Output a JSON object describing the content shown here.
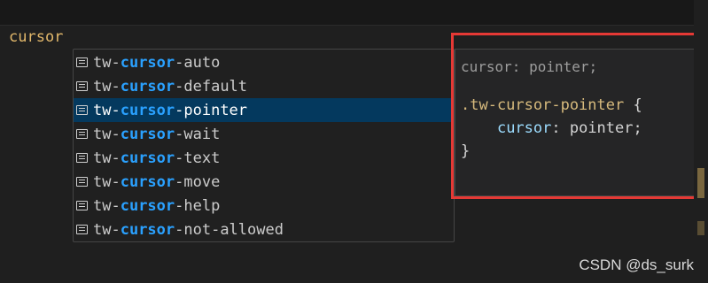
{
  "editor": {
    "typed_text": "cursor"
  },
  "suggestions": {
    "selected_index": 2,
    "items": [
      {
        "prefix": "tw-",
        "match": "cursor",
        "suffix": "-auto"
      },
      {
        "prefix": "tw-",
        "match": "cursor",
        "suffix": "-default"
      },
      {
        "prefix": "tw-",
        "match": "cursor",
        "suffix": "-pointer"
      },
      {
        "prefix": "tw-",
        "match": "cursor",
        "suffix": "-wait"
      },
      {
        "prefix": "tw-",
        "match": "cursor",
        "suffix": "-text"
      },
      {
        "prefix": "tw-",
        "match": "cursor",
        "suffix": "-move"
      },
      {
        "prefix": "tw-",
        "match": "cursor",
        "suffix": "-help"
      },
      {
        "prefix": "tw-",
        "match": "cursor",
        "suffix": "-not-allowed"
      }
    ]
  },
  "details": {
    "signature": "cursor: pointer;",
    "selector": ".tw-cursor-pointer",
    "open_brace": " {",
    "indent": "    ",
    "property": "cursor",
    "value": ": pointer;",
    "close_brace": "}"
  },
  "watermark": "CSDN @ds_surk",
  "colors": {
    "match_highlight": "#2aa1ff",
    "selected_row": "#04395e",
    "annotation_box": "#e53935",
    "typed_text": "#e2b86b"
  },
  "icons": {
    "suggestion_kind": "keyword-icon"
  }
}
